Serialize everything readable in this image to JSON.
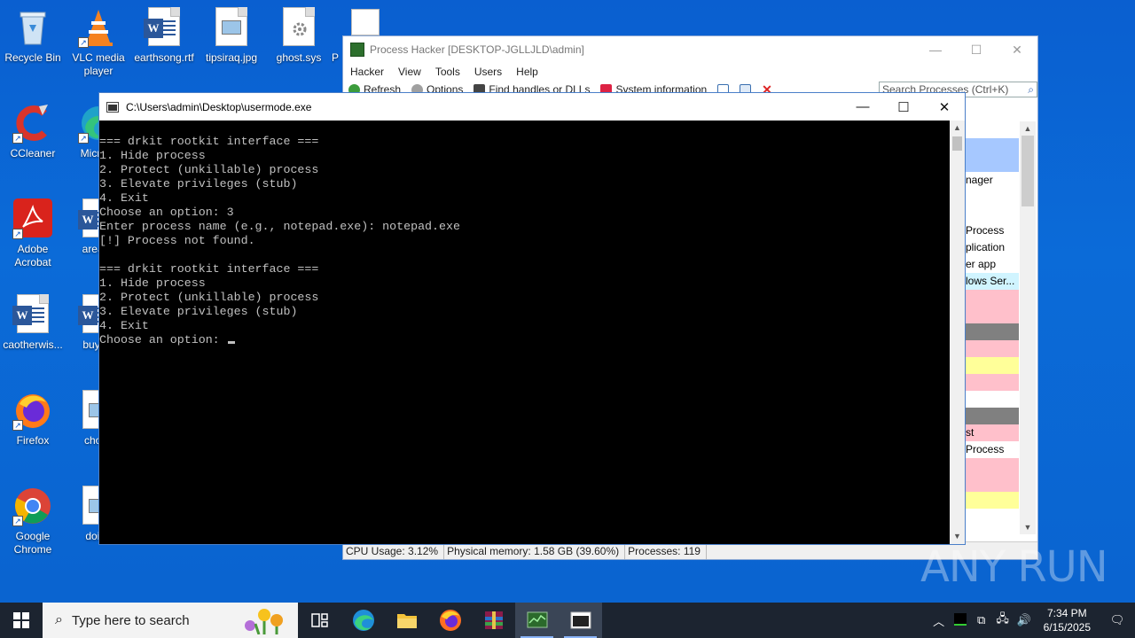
{
  "desktop": {
    "icons": [
      {
        "label": "Recycle Bin"
      },
      {
        "label": "VLC media player"
      },
      {
        "label": "earthsong.rtf"
      },
      {
        "label": "tipsiraq.jpg"
      },
      {
        "label": "ghost.sys"
      },
      {
        "label": "P"
      },
      {
        "label": "CCleaner"
      },
      {
        "label": "Micr Ed"
      },
      {
        "label": "Adobe Acrobat"
      },
      {
        "label": "areasn"
      },
      {
        "label": "caotherwis..."
      },
      {
        "label": "buystu"
      },
      {
        "label": "Firefox"
      },
      {
        "label": "choos"
      },
      {
        "label": "Google Chrome"
      },
      {
        "label": "doing"
      }
    ]
  },
  "process_hacker": {
    "title": "Process Hacker [DESKTOP-JGLLJLD\\admin]",
    "menu": [
      "Hacker",
      "View",
      "Tools",
      "Users",
      "Help"
    ],
    "toolbar": {
      "refresh": "Refresh",
      "options": "Options",
      "find_handles": "Find handles or DLLs",
      "system_info": "System information"
    },
    "search_placeholder": "Search Processes (Ctrl+K)",
    "list_fragments": [
      "nager",
      "Process",
      "plication",
      "er app",
      "lows Ser...",
      "st",
      "Process"
    ],
    "status": {
      "cpu": "CPU Usage: 3.12%",
      "memory": "Physical memory: 1.58 GB (39.60%)",
      "processes": "Processes: 119"
    }
  },
  "console": {
    "title": "C:\\Users\\admin\\Desktop\\usermode.exe",
    "lines": [
      "=== drkit rootkit interface ===",
      "1. Hide process",
      "2. Protect (unkillable) process",
      "3. Elevate privileges (stub)",
      "4. Exit",
      "Choose an option: 3",
      "Enter process name (e.g., notepad.exe): notepad.exe",
      "[!] Process not found.",
      "",
      "=== drkit rootkit interface ===",
      "1. Hide process",
      "2. Protect (unkillable) process",
      "3. Elevate privileges (stub)",
      "4. Exit"
    ],
    "prompt": "Choose an option: "
  },
  "watermark": "ANY RUN",
  "taskbar": {
    "search_placeholder": "Type here to search",
    "time": "7:34 PM",
    "date": "6/15/2025"
  },
  "colors": {
    "desktop_bg": "#0a63cf",
    "taskbar_bg": "#1c2430",
    "console_text": "#c0c0c0",
    "row_pink": "#ffc0cb",
    "row_gray": "#808080",
    "row_yellow": "#ffff99",
    "row_blue": "#a6c8ff",
    "row_cyan": "#d0f4ff"
  }
}
